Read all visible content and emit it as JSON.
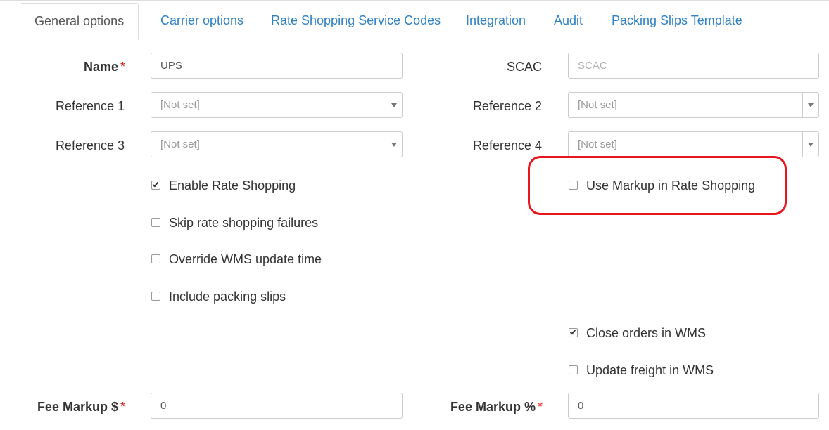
{
  "tabs": [
    "General options",
    "Carrier options",
    "Rate Shopping Service Codes",
    "Integration",
    "Audit",
    "Packing Slips Template"
  ],
  "form": {
    "name": {
      "label": "Name",
      "required_mark": "*",
      "value": "UPS"
    },
    "scac": {
      "label": "SCAC",
      "placeholder": "SCAC"
    },
    "reference1": {
      "label": "Reference 1",
      "value": "[Not set]"
    },
    "reference2": {
      "label": "Reference 2",
      "value": "[Not set]"
    },
    "reference3": {
      "label": "Reference 3",
      "value": "[Not set]"
    },
    "reference4": {
      "label": "Reference 4",
      "value": "[Not set]"
    },
    "fee_markup_dollar": {
      "label": "Fee Markup $",
      "required_mark": "*",
      "value": "0"
    },
    "fee_markup_percent": {
      "label": "Fee Markup %",
      "required_mark": "*",
      "value": "0"
    }
  },
  "checkboxes": {
    "enable_rate_shopping": {
      "label": "Enable Rate Shopping",
      "checked": true
    },
    "skip_failures": {
      "label": "Skip rate shopping failures",
      "checked": false
    },
    "override_wms": {
      "label": "Override WMS update time",
      "checked": false
    },
    "include_packing": {
      "label": "Include packing slips",
      "checked": false
    },
    "use_markup": {
      "label": "Use Markup in Rate Shopping",
      "checked": false
    },
    "close_orders": {
      "label": "Close orders in WMS",
      "checked": true
    },
    "update_freight": {
      "label": "Update freight in WMS",
      "checked": false
    }
  },
  "colors": {
    "accent": "#2f81c5",
    "required": "#e02020",
    "highlight": "#e8151d"
  }
}
